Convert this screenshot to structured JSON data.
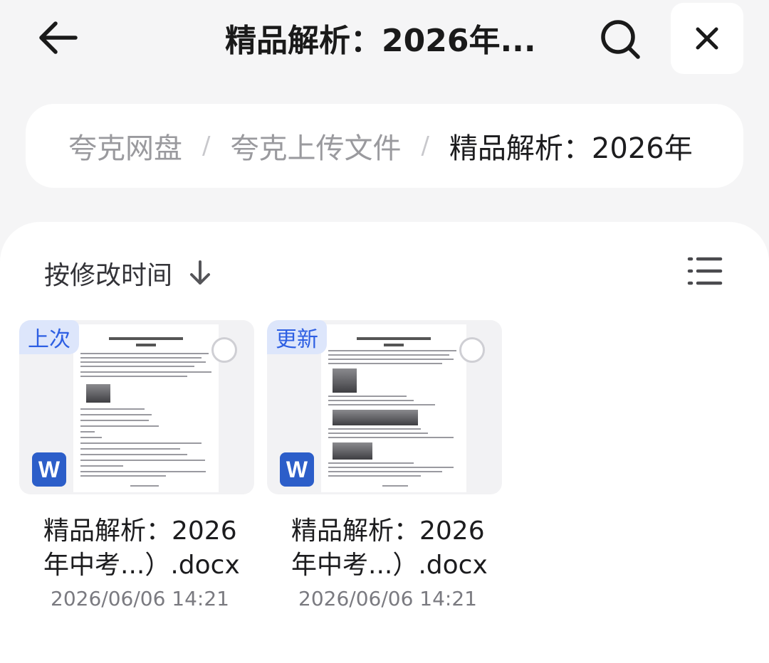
{
  "header": {
    "title": "精品解析：2026年...",
    "back_icon": "back-arrow-icon",
    "search_icon": "search-icon",
    "close_icon": "close-icon"
  },
  "breadcrumb": {
    "items": [
      "夸克网盘",
      "夸克上传文件",
      "精品解析：2026年"
    ],
    "separator": "/"
  },
  "toolbar": {
    "sort_label": "按修改时间",
    "sort_icon": "arrow-down-icon",
    "view_icon": "list-view-icon"
  },
  "files": [
    {
      "tag": "上次",
      "name": "精品解析：2026年中考...）.docx",
      "date": "2026/06/06 14:21",
      "type_icon": "word-icon",
      "type_letter": "W"
    },
    {
      "tag": "更新",
      "name": "精品解析：2026年中考...）.docx",
      "date": "2026/06/06 14:21",
      "type_icon": "word-icon",
      "type_letter": "W"
    }
  ],
  "colors": {
    "accent": "#2d5fe3",
    "tag_bg": "#dde6fb",
    "word_blue": "#2c5ec9",
    "background": "#f5f5f6"
  }
}
